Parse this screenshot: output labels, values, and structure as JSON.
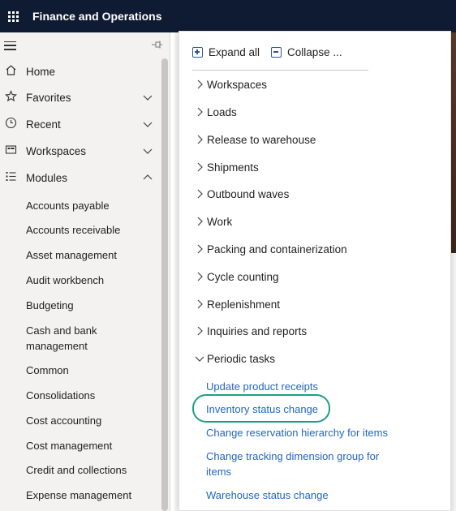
{
  "app": {
    "title": "Finance and Operations"
  },
  "nav": {
    "items": [
      {
        "label": "Home",
        "icon": "home-icon"
      },
      {
        "label": "Favorites",
        "icon": "star-icon"
      },
      {
        "label": "Recent",
        "icon": "clock-icon"
      },
      {
        "label": "Workspaces",
        "icon": "workspace-icon"
      },
      {
        "label": "Modules",
        "icon": "list-icon"
      }
    ],
    "modules": [
      "Accounts payable",
      "Accounts receivable",
      "Asset management",
      "Audit workbench",
      "Budgeting",
      "Cash and bank management",
      "Common",
      "Consolidations",
      "Cost accounting",
      "Cost management",
      "Credit and collections",
      "Expense management"
    ]
  },
  "flyout": {
    "expand_all": "Expand all",
    "collapse_all": "Collapse ...",
    "groups": [
      "Workspaces",
      "Loads",
      "Release to warehouse",
      "Shipments",
      "Outbound waves",
      "Work",
      "Packing and containerization",
      "Cycle counting",
      "Replenishment",
      "Inquiries and reports",
      "Periodic tasks"
    ],
    "periodic_tasks": [
      "Update product receipts",
      "Inventory status change",
      "Change reservation hierarchy for items",
      "Change tracking dimension group for items",
      "Warehouse status change"
    ]
  },
  "colors": {
    "topbar": "#0f1b33",
    "link": "#2266c5",
    "highlight": "#1e9e86"
  }
}
